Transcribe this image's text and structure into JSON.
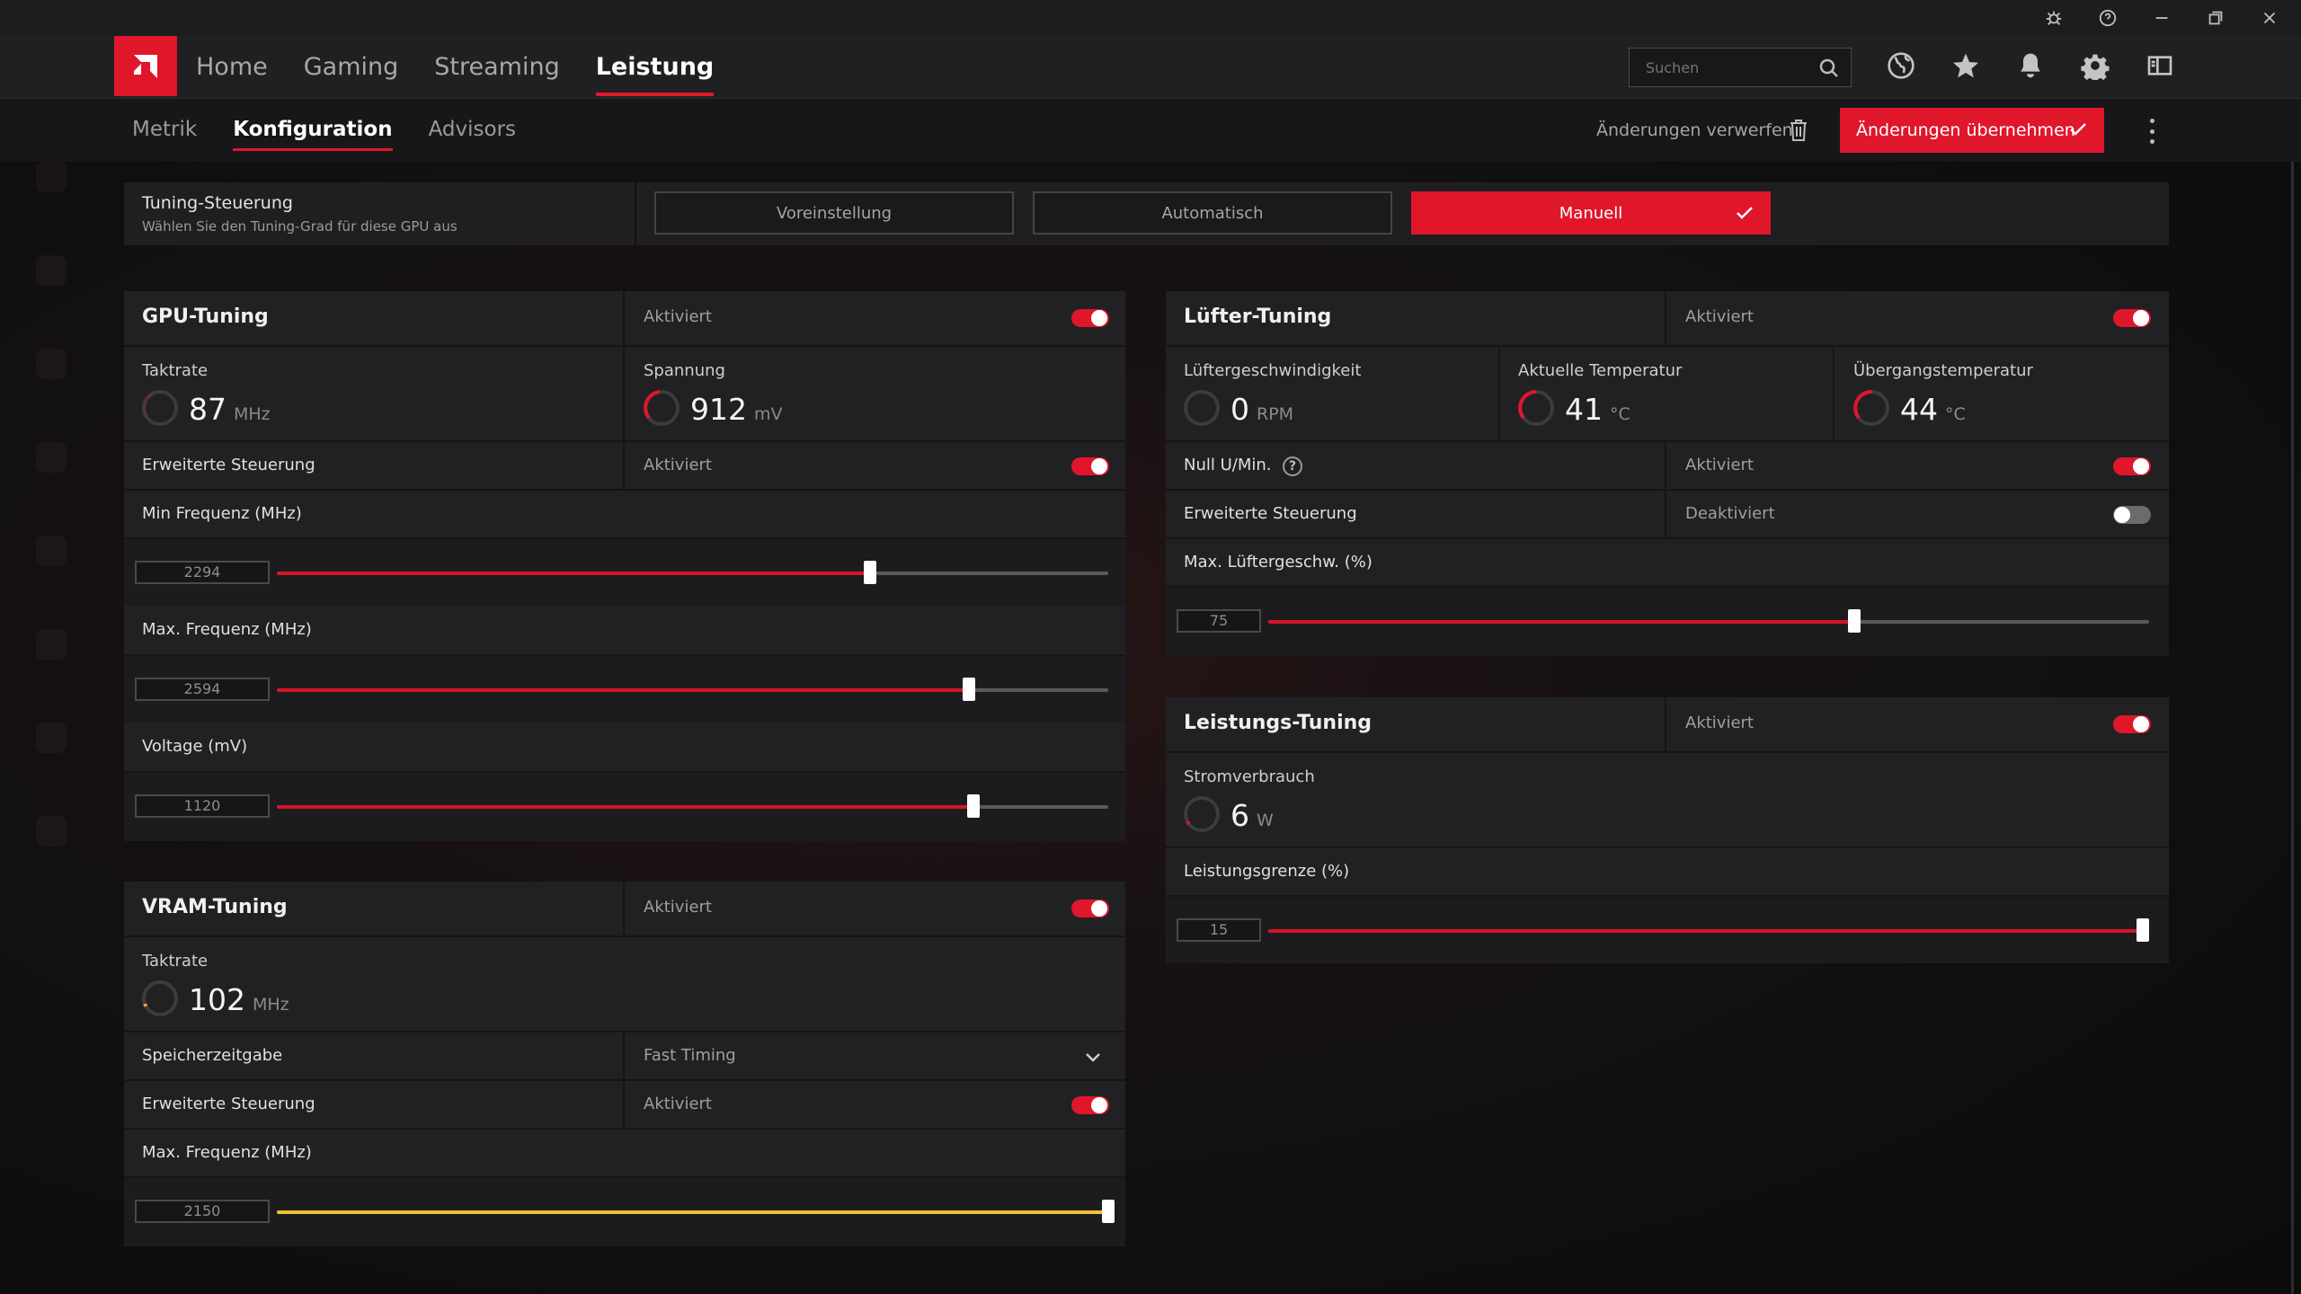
{
  "nav": {
    "tabs": [
      "Home",
      "Gaming",
      "Streaming",
      "Leistung"
    ],
    "active": "Leistung",
    "search_placeholder": "Suchen"
  },
  "subnav": {
    "tabs": [
      "Metrik",
      "Konfiguration",
      "Advisors"
    ],
    "active": "Konfiguration",
    "discard_label": "Änderungen verwerfen",
    "apply_label": "Änderungen übernehmen"
  },
  "tuning_control": {
    "title": "Tuning-Steuerung",
    "subtitle": "Wählen Sie den Tuning-Grad für diese GPU aus",
    "options": [
      "Voreinstellung",
      "Automatisch",
      "Manuell"
    ],
    "selected": "Manuell"
  },
  "gpu_tuning": {
    "title": "GPU-Tuning",
    "status": "Aktiviert",
    "enabled": true,
    "clock": {
      "label": "Taktrate",
      "value": "87",
      "unit": "MHz"
    },
    "voltage": {
      "label": "Spannung",
      "value": "912",
      "unit": "mV"
    },
    "advanced": {
      "label": "Erweiterte Steuerung",
      "status": "Aktiviert",
      "enabled": true
    },
    "min_freq": {
      "label": "Min Frequenz (MHz)",
      "value": "2294",
      "fraction": 0.714
    },
    "max_freq": {
      "label": "Max. Frequenz (MHz)",
      "value": "2594",
      "fraction": 0.832
    },
    "volt_slider": {
      "label": "Voltage (mV)",
      "value": "1120",
      "fraction": 0.838
    }
  },
  "vram_tuning": {
    "title": "VRAM-Tuning",
    "status": "Aktiviert",
    "enabled": true,
    "clock": {
      "label": "Taktrate",
      "value": "102",
      "unit": "MHz"
    },
    "timing": {
      "label": "Speicherzeitgabe",
      "value": "Fast Timing"
    },
    "advanced": {
      "label": "Erweiterte Steuerung",
      "status": "Aktiviert",
      "enabled": true
    },
    "max_freq": {
      "label": "Max. Frequenz (MHz)",
      "value": "2150",
      "fraction": 1.0
    }
  },
  "fan_tuning": {
    "title": "Lüfter-Tuning",
    "status": "Aktiviert",
    "enabled": true,
    "fan_speed": {
      "label": "Lüftergeschwindigkeit",
      "value": "0",
      "unit": "RPM"
    },
    "current_temp": {
      "label": "Aktuelle Temperatur",
      "value": "41",
      "unit": "°C"
    },
    "junction_temp": {
      "label": "Übergangstemperatur",
      "value": "44",
      "unit": "°C"
    },
    "zero_rpm": {
      "label": "Null U/Min.",
      "status": "Aktiviert",
      "enabled": true
    },
    "advanced": {
      "label": "Erweiterte Steuerung",
      "status": "Deaktiviert",
      "enabled": false
    },
    "max_speed": {
      "label": "Max. Lüftergeschw. (%)",
      "value": "75",
      "fraction": 0.665
    }
  },
  "power_tuning": {
    "title": "Leistungs-Tuning",
    "status": "Aktiviert",
    "enabled": true,
    "power": {
      "label": "Stromverbrauch",
      "value": "6",
      "unit": "W"
    },
    "limit": {
      "label": "Leistungsgrenze (%)",
      "value": "15",
      "fraction": 0.993
    }
  },
  "colors": {
    "accent": "#e0162b",
    "vram_slider": "#f1c232"
  }
}
